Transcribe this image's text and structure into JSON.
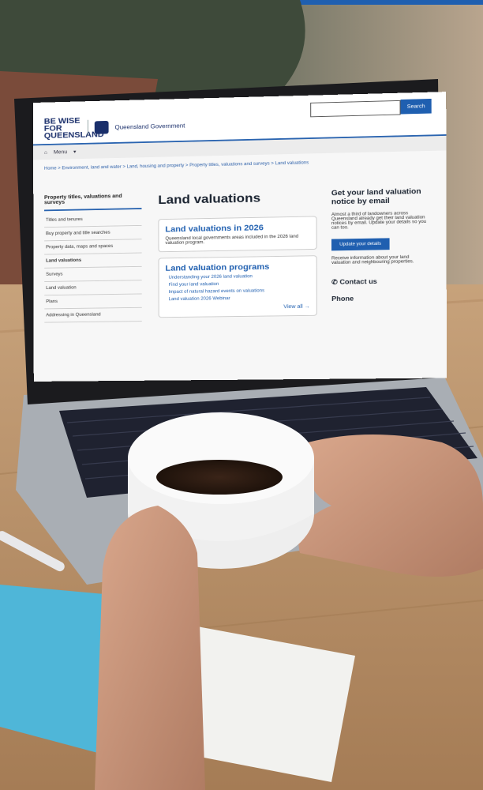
{
  "screen": {
    "logo_text_1": "BE WISE FOR QUEENSLAND",
    "logo_text_2": "Queensland Government",
    "search_label": "Search",
    "menu_label": "Menu",
    "breadcrumb": "Home > Environment, land and water > Land, housing and property > Property titles, valuations and surveys > Land valuations",
    "sidebar": {
      "title": "Property titles, valuations and surveys",
      "items": [
        {
          "label": "Titles and tenures"
        },
        {
          "label": "Buy property and title searches"
        },
        {
          "label": "Property data, maps and spaces"
        },
        {
          "label": "Land valuations"
        },
        {
          "label": "Surveys"
        },
        {
          "label": "Land valuation"
        },
        {
          "label": "Plans"
        },
        {
          "label": "Addressing in Queensland"
        }
      ]
    },
    "main": {
      "title": "Land valuations",
      "card1": {
        "title": "Land valuations in 2026",
        "body": "Queensland local governments areas included in the 2026 land valuation program."
      },
      "card2": {
        "title": "Land valuation programs",
        "links": [
          "Understanding your 2026 land valuation",
          "Find your land valuation",
          "Impact of natural hazard events on valuations",
          "Land valuation 2026 Webinar"
        ],
        "view_all": "View all"
      }
    },
    "aside": {
      "heading": "Get your land valuation notice by email",
      "body": "Almost a third of landowners across Queensland already get their land valuation notices by email. Update your details so you can too.",
      "button": "Update your details",
      "note": "Receive information about your land valuation and neighbouring properties.",
      "contact": "Contact us",
      "phone": "Phone"
    }
  },
  "colors": {
    "qld_blue": "#1f5fb0",
    "desk": "#b9906a",
    "laptop_body": "#9aa0a8",
    "screen_bezel": "#1b1b1e"
  }
}
